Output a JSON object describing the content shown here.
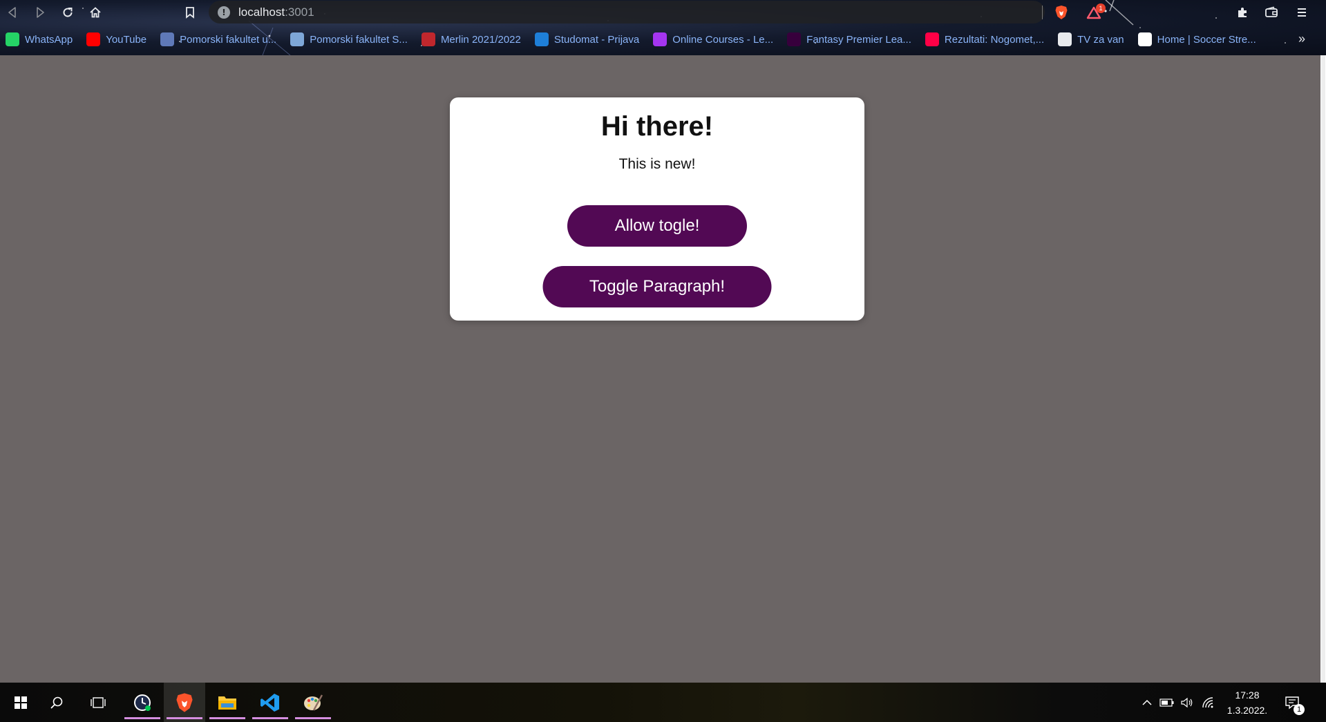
{
  "browser": {
    "url_host": "localhost",
    "url_port": ":3001",
    "shields_badge": "1",
    "bookmarks": [
      {
        "label": "WhatsApp",
        "icon": "whatsapp-icon",
        "color": "#25d366"
      },
      {
        "label": "YouTube",
        "icon": "youtube-icon",
        "color": "#ff0000"
      },
      {
        "label": "Pomorski fakultet u...",
        "icon": "faculty-icon",
        "color": "#5f79b8"
      },
      {
        "label": "Pomorski fakultet S...",
        "icon": "globe-icon",
        "color": "#7ea7d8"
      },
      {
        "label": "Merlin 2021/2022",
        "icon": "merlin-icon",
        "color": "#c0272d"
      },
      {
        "label": "Studomat - Prijava",
        "icon": "studomat-icon",
        "color": "#1e7fd8"
      },
      {
        "label": "Online Courses - Le...",
        "icon": "udemy-icon",
        "color": "#a435f0"
      },
      {
        "label": "Fantasy Premier Lea...",
        "icon": "premier-league-icon",
        "color": "#37003c"
      },
      {
        "label": "Rezultati: Nogomet,...",
        "icon": "rezultati-icon",
        "color": "#ff0046"
      },
      {
        "label": "TV za van",
        "icon": "tv-globe-icon",
        "color": "#e8eaed"
      },
      {
        "label": "Home | Soccer Stre...",
        "icon": "soccer-stream-icon",
        "color": "#ffffff"
      }
    ],
    "bookmarks_more": "»"
  },
  "page": {
    "title": "Hi there!",
    "paragraph": "This is new!",
    "allow_toggle_label": "Allow togle!",
    "toggle_paragraph_label": "Toggle Paragraph!",
    "button_color": "#520954",
    "background_color": "#6b6565"
  },
  "taskbar": {
    "time": "17:28",
    "date": "1.3.2022.",
    "notification_count": "1"
  }
}
